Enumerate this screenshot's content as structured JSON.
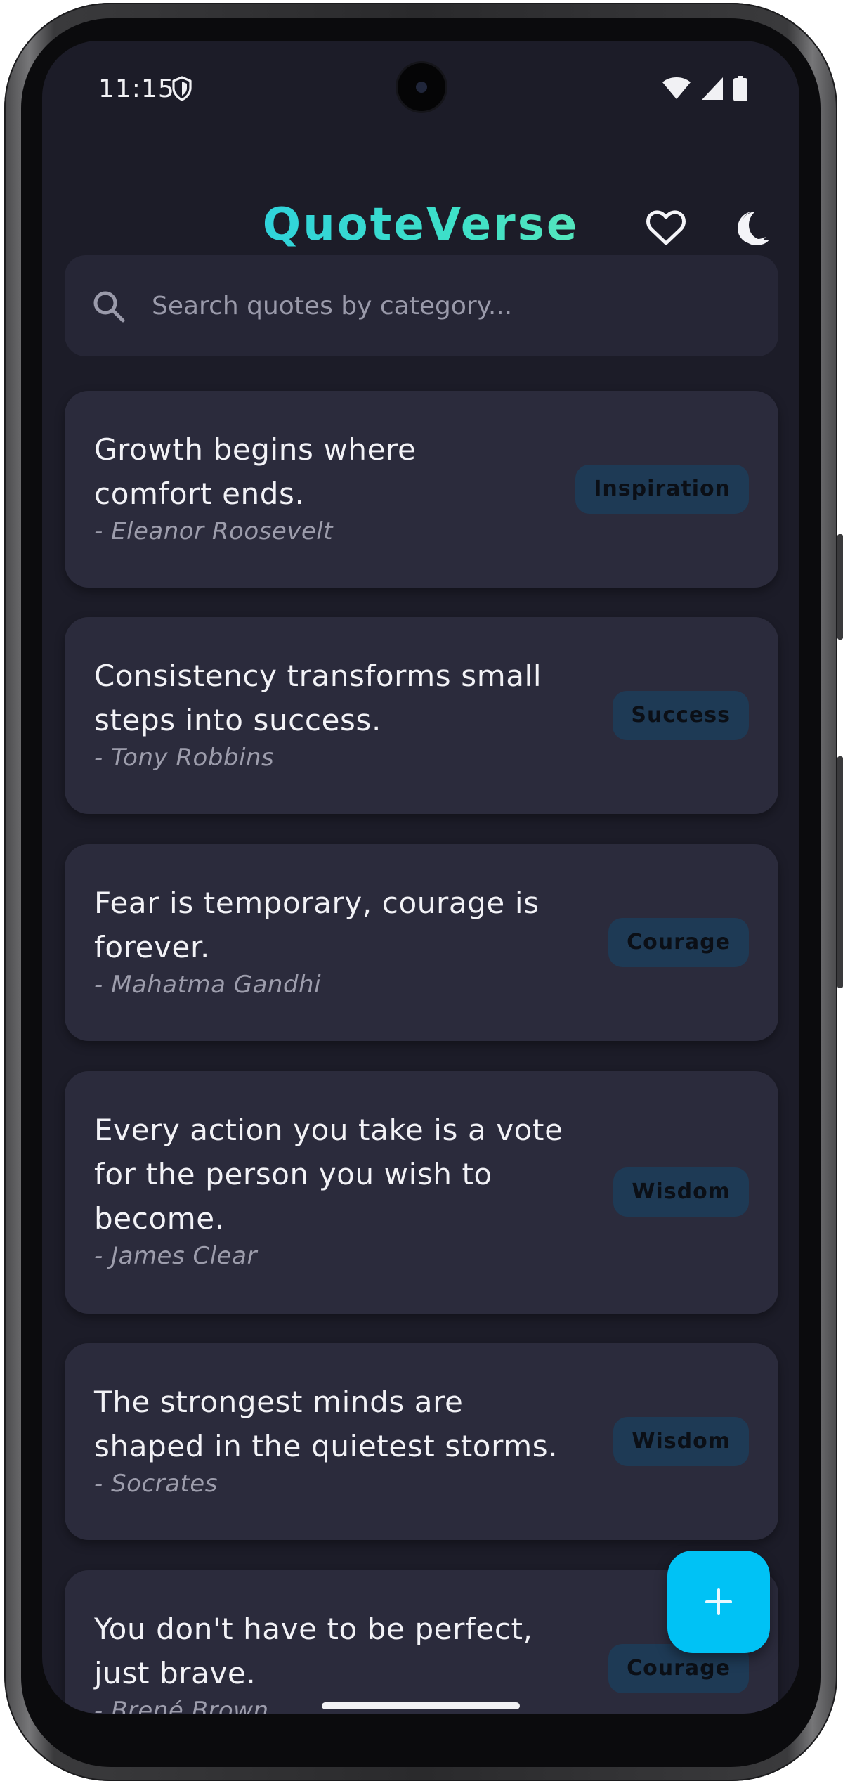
{
  "status_bar": {
    "time": "11:15"
  },
  "header": {
    "title": "QuoteVerse",
    "favorites_icon": "heart-icon",
    "theme_icon": "moon-icon"
  },
  "search": {
    "placeholder": "Search quotes by category...",
    "value": ""
  },
  "quotes": [
    {
      "text_lines": [
        "Growth begins where",
        "comfort ends."
      ],
      "author": "- Eleanor Roosevelt",
      "category": "Inspiration"
    },
    {
      "text_lines": [
        "Consistency transforms small",
        "steps into success."
      ],
      "author": "- Tony Robbins",
      "category": "Success"
    },
    {
      "text_lines": [
        "Fear is temporary, courage is",
        "forever."
      ],
      "author": "- Mahatma Gandhi",
      "category": "Courage"
    },
    {
      "text_lines": [
        "Every action you take is a vote",
        "for the person you wish to",
        "become."
      ],
      "author": "- James Clear",
      "category": "Wisdom"
    },
    {
      "text_lines": [
        "The strongest minds are",
        "shaped in the quietest storms."
      ],
      "author": "- Socrates",
      "category": "Wisdom"
    },
    {
      "text_lines": [
        "You don't have to be perfect,",
        "just brave."
      ],
      "author": "- Brené Brown",
      "category": "Courage"
    }
  ],
  "fab": {
    "icon": "plus-icon"
  },
  "colors": {
    "background": "#1c1c28",
    "card": "#2b2b3c",
    "accent": "#00c2f5",
    "badge": "#1e3a55",
    "title_gradient_start": "#1fc4f0",
    "title_gradient_end": "#7ef0a8"
  }
}
